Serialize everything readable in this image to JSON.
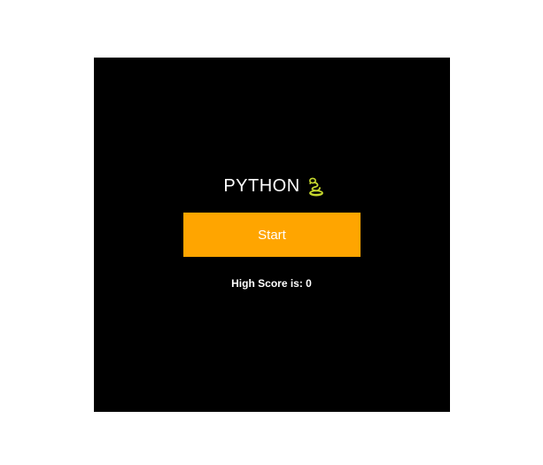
{
  "game": {
    "title": "PYTHON",
    "title_icon": "snake-icon",
    "start_label": "Start",
    "high_score_label": "High Score is:",
    "high_score_value": "0"
  },
  "colors": {
    "background": "#000000",
    "page": "#ffffff",
    "start_button": "#ffa500",
    "text": "#ffffff",
    "snake_icon": "#c6d82e"
  }
}
